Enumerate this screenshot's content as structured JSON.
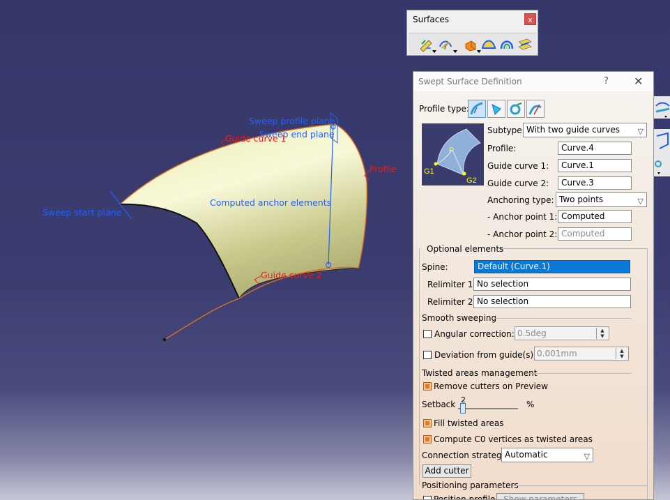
{
  "viewport": {
    "labels": {
      "sweep_profile_plane": "Sweep profile plane",
      "sweep_end_plane": "Sweep end plane",
      "guide_curve_1": "Guide curve 1",
      "profile": "Profile",
      "computed_anchor": "Computed anchor elements",
      "sweep_start_plane": "Sweep start plane",
      "guide_curve_2": "Guide curve 2"
    }
  },
  "surfaces_toolbar": {
    "title": "Surfaces",
    "close": "x",
    "icons": [
      "extrude-icon",
      "revolve-icon",
      "sweep-icon",
      "fill-icon",
      "loft-icon",
      "blend-icon"
    ]
  },
  "dialog": {
    "title": "Swept Surface Definition",
    "help": "?",
    "close": "✕",
    "profile_type_label": "Profile type:",
    "subtype_label": "Subtype:",
    "subtype_value": "With two guide curves",
    "profile_label": "Profile:",
    "profile_value": "Curve.4",
    "guide1_label": "Guide curve 1:",
    "guide1_value": "Curve.1",
    "guide2_label": "Guide curve 2:",
    "guide2_value": "Curve.3",
    "anchoring_label": "Anchoring type:",
    "anchoring_value": "Two points",
    "anchor1_label": "- Anchor point 1:",
    "anchor1_value": "Computed",
    "anchor2_label": "- Anchor point 2:",
    "anchor2_value": "Computed",
    "preview_labels": {
      "p": "P",
      "g1": "G1",
      "g2": "G2"
    },
    "optional_title": "Optional elements",
    "spine_label": "Spine:",
    "spine_value": "Default (Curve.1)",
    "relim1_label": "Relimiter 1:",
    "relim1_value": "No selection",
    "relim2_label": "Relimiter 2:",
    "relim2_value": "No selection",
    "smooth_title": "Smooth sweeping",
    "angular_label": "Angular correction:",
    "angular_value": "0.5deg",
    "angular_checked": false,
    "deviation_label": "Deviation from guide(s):",
    "deviation_value": "0.001mm",
    "deviation_checked": false,
    "twisted_title": "Twisted areas management",
    "remove_cutters_label": "Remove cutters on Preview",
    "remove_cutters_checked": true,
    "setback_label": "Setback",
    "setback_value": "2",
    "setback_unit": "%",
    "fill_twisted_label": "Fill twisted areas",
    "fill_twisted_checked": true,
    "compute_c0_label": "Compute C0 vertices as twisted areas",
    "compute_c0_checked": true,
    "connection_label": "Connection strategy:",
    "connection_value": "Automatic",
    "add_cutter_label": "Add cutter",
    "positioning_title": "Positioning parameters",
    "position_profile_label": "Position profile",
    "show_parameters_label": "Show parameters >>"
  },
  "colors": {
    "annotation_blue": "#1f5fff",
    "annotation_red": "#e02020",
    "surface": "#e4e4a8",
    "selection": "#0a78d7",
    "checkbox_on": "#e07a2a"
  }
}
